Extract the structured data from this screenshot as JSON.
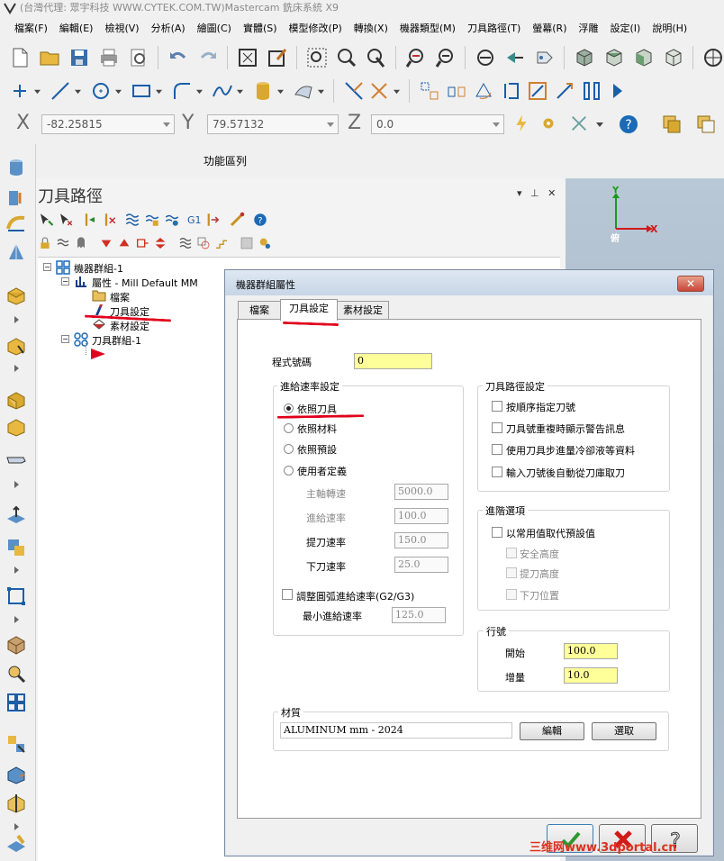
{
  "titlebar": {
    "text": "(台灣代理: 眾宇科技  WWW.CYTEK.COM.TW)Mastercam  銑床系統  X9"
  },
  "menu": [
    "檔案(F)",
    "編輯(E)",
    "檢視(V)",
    "分析(A)",
    "繪圖(C)",
    "實體(S)",
    "模型修改(P)",
    "轉換(X)",
    "機器類型(M)",
    "刀具路徑(T)",
    "螢幕(R)",
    "浮雕",
    "設定(I)",
    "說明(H)"
  ],
  "coords": {
    "x_label": "X",
    "x_value": "-82.25815",
    "y_label": "Y",
    "y_value": "79.57132",
    "z_label": "Z",
    "z_value": "0.0"
  },
  "function_area_label": "功能區列",
  "panel": {
    "title": "刀具路徑",
    "g1_label": "G1"
  },
  "tree": {
    "machine_group": "機器群組-1",
    "properties": "屬性 - Mill Default MM",
    "files": "檔案",
    "tool_settings": "刀具設定",
    "stock_setup": "素材設定",
    "toolpath_group": "刀具群組-1"
  },
  "viewport": {
    "axis_y": "Y",
    "axis_x": "X",
    "view_label": "俯"
  },
  "dialog": {
    "title": "機器群組屬性",
    "close_label": "✕",
    "tabs": [
      "檔案",
      "刀具設定",
      "素材設定"
    ],
    "program_number_label": "程式號碼",
    "program_number_value": "0",
    "feed_group_label": "進給速率設定",
    "feed_options": [
      "依照刀具",
      "依照材料",
      "依照預設",
      "使用者定義"
    ],
    "feed_selected": "依照刀具",
    "spindle_speed_label": "主軸轉速",
    "spindle_speed_value": "5000.0",
    "feed_rate_label": "進給速率",
    "feed_rate_value": "100.0",
    "retract_rate_label": "提刀速率",
    "retract_rate_value": "150.0",
    "plunge_rate_label": "下刀速率",
    "plunge_rate_value": "25.0",
    "arc_adjust_label": "調整圓弧進給速率(G2/G3)",
    "min_feed_label": "最小進給速率",
    "min_feed_value": "125.0",
    "toolpath_group_label": "刀具路徑設定",
    "toolpath_options": [
      "按順序指定刀號",
      "刀具號重複時顯示警告訊息",
      "使用刀具步進量冷卻液等資料",
      "輸入刀號後自動從刀庫取刀"
    ],
    "advanced_group_label": "進階選項",
    "advanced_main": "以常用值取代預設值",
    "advanced_options": [
      "安全高度",
      "提刀高度",
      "下刀位置"
    ],
    "line_group_label": "行號",
    "line_start_label": "開始",
    "line_start_value": "100.0",
    "line_inc_label": "增量",
    "line_inc_value": "10.0",
    "material_group_label": "材質",
    "material_value": "ALUMINUM mm - 2024",
    "edit_button": "編輯",
    "select_button": "選取"
  },
  "watermark": "三维网www.3dportal.cn",
  "colors": {
    "highlight_yellow": "#ffff99",
    "annotation_red": "#e0001b",
    "viewport_bg": "#b3c1cf"
  }
}
